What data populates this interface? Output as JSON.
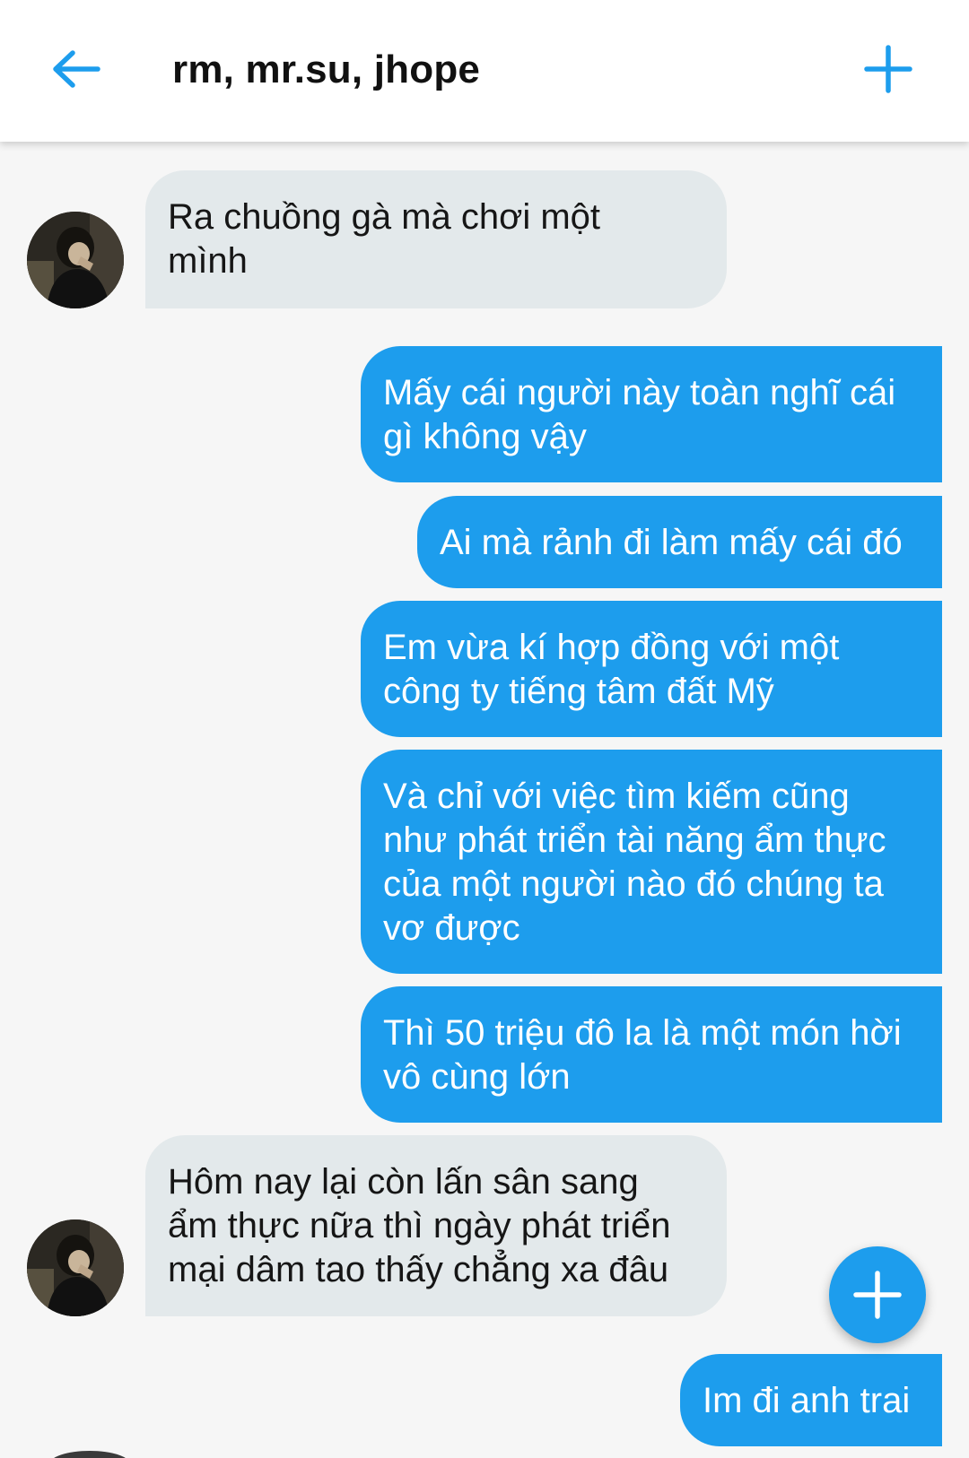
{
  "header": {
    "title": "rm, mr.su, jhope",
    "back_icon": "arrow-left-icon",
    "add_icon": "plus-icon",
    "accent": "#1d9ded"
  },
  "messages": [
    {
      "side": "incoming",
      "text": "Ra chuồng gà mà chơi một\nmình"
    },
    {
      "side": "outgoing",
      "text": "Mấy cái người này toàn nghĩ cái\ngì không vậy"
    },
    {
      "side": "outgoing",
      "text": "Ai mà rảnh đi làm mấy cái đó"
    },
    {
      "side": "outgoing",
      "text": "Em vừa kí hợp đồng với một\ncông ty tiếng tâm đất Mỹ"
    },
    {
      "side": "outgoing",
      "text": "Và chỉ với việc tìm kiếm cũng\nnhư phát triển tài năng ẩm thực\ncủa một người nào đó chúng ta\nvơ được"
    },
    {
      "side": "outgoing",
      "text": "Thì 50 triệu đô la là một món hời\nvô cùng lớn"
    },
    {
      "side": "incoming",
      "text": "Hôm nay lại còn lấn sân sang\nẩm thực nữa thì ngày phát triển\nmại dâm tao thấy chẳng xa đâu"
    },
    {
      "side": "outgoing",
      "text": "Im đi anh trai"
    }
  ],
  "fab": {
    "icon": "plus-icon"
  },
  "colors": {
    "outgoing_bubble": "#1d9ded",
    "incoming_bubble": "#e3e9eb",
    "background": "#f6f6f6"
  }
}
